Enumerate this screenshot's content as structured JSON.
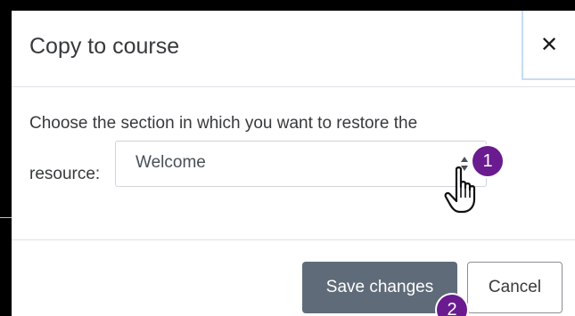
{
  "dialog": {
    "title": "Copy to course",
    "close_icon": "close-icon",
    "prompt_line1": "Choose the section in which you want to restore the",
    "prompt_line2": "resource:",
    "select": {
      "value": "Welcome",
      "arrows_icon": "select-arrows-icon"
    },
    "save_label": "Save changes",
    "cancel_label": "Cancel"
  },
  "annotations": {
    "step1": "1",
    "step2": "2",
    "cursor_icon": "hand-pointer-icon",
    "badge_color": "#6a1b8f"
  },
  "colors": {
    "save_button": "#5f6b78",
    "frame": "#000000",
    "close_focus_border": "#c8dcf3"
  }
}
